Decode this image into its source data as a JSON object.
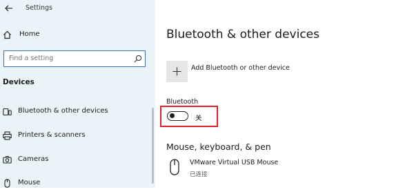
{
  "window": {
    "title": "Settings"
  },
  "sidebar": {
    "home_label": "Home",
    "search_placeholder": "Find a setting",
    "section_title": "Devices",
    "items": [
      {
        "label": "Bluetooth & other devices",
        "icon": "bluetooth-devices-icon"
      },
      {
        "label": "Printers & scanners",
        "icon": "printer-icon"
      },
      {
        "label": "Cameras",
        "icon": "camera-icon"
      },
      {
        "label": "Mouse",
        "icon": "mouse-icon"
      }
    ]
  },
  "main": {
    "title": "Bluetooth & other devices",
    "add_device_label": "Add Bluetooth or other device",
    "bluetooth": {
      "label": "Bluetooth",
      "state": "关",
      "enabled": false
    },
    "mouse_keyboard_pen": {
      "heading": "Mouse, keyboard, & pen",
      "devices": [
        {
          "name": "VMware Virtual USB Mouse",
          "status": "已连接",
          "icon": "mouse-icon"
        }
      ]
    }
  },
  "colors": {
    "sidebar_bg": "#e9f3f8",
    "highlight": "#e0202a",
    "search_border": "#3c6fb5"
  }
}
